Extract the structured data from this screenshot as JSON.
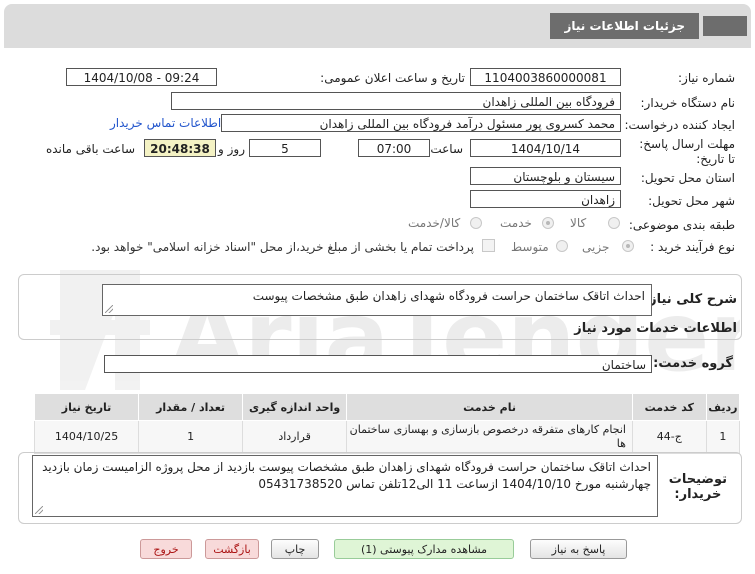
{
  "header": {
    "title": "جزئیات اطلاعات نیاز"
  },
  "watermark": {
    "text": "AriaTender.neT"
  },
  "form": {
    "need_number_label": "شماره نیاز:",
    "need_number": "1104003860000081",
    "announce_label": "تاریخ و ساعت اعلان عمومی:",
    "announce_value": "1404/10/08 - 09:24",
    "buyer_org_label": "نام دستگاه خریدار:",
    "buyer_org": "فرودگاه بین المللی زاهدان",
    "creator_label": "ایجاد کننده درخواست:",
    "creator": "محمد کسروی پور مسئول درآمد فرودگاه بین المللی زاهدان",
    "contact_link": "اطلاعات تماس خریدار",
    "deadline_label": "مهلت ارسال پاسخ: تا تاریخ:",
    "deadline_date": "1404/10/14",
    "time_label": "ساعت",
    "deadline_time": "07:00",
    "days_value": "5",
    "days_label": "روز و",
    "remaining_time": "20:48:38",
    "remaining_label": "ساعت باقی مانده",
    "province_label": "استان محل تحویل:",
    "province": "سیستان و بلوچستان",
    "city_label": "شهر محل تحویل:",
    "city": "زاهدان",
    "category_label": "طبقه بندی موضوعی:",
    "category_options": [
      "کالا",
      "خدمت",
      "کالا/خدمت"
    ],
    "process_label": "نوع فرآیند خرید :",
    "process_options": [
      "جزیی",
      "متوسط"
    ],
    "payment_note": "پرداخت تمام یا بخشی از مبلغ خرید،از محل \"اسناد خزانه اسلامی\" خواهد بود."
  },
  "summary": {
    "label": "شرح کلی نیاز:",
    "text": "احداث اتاقک ساختمان حراست فرودگاه شهدای زاهدان طبق مشخصات پیوست"
  },
  "services": {
    "heading": "اطلاعات خدمات مورد نیاز",
    "group_label": "گروه خدمت:",
    "group_value": "ساختمان",
    "columns": [
      "ردیف",
      "کد خدمت",
      "نام خدمت",
      "واحد اندازه گیری",
      "تعداد / مقدار",
      "تاریخ نیاز"
    ],
    "rows": [
      {
        "row": "1",
        "code": "ج-44",
        "name": "انجام کارهای متفرقه درخصوص بازسازی و بهسازی ساختمان ها",
        "unit": "قرارداد",
        "qty": "1",
        "date": "1404/10/25"
      }
    ]
  },
  "buyer_notes": {
    "label_line1": "توضیحات",
    "label_line2": "خریدار:",
    "line1": "احداث اتاقک ساختمان حراست فرودگاه شهدای زاهدان طبق مشخصات پیوست بازدید از محل پروژه الزامیست زمان بازدید",
    "line2": "چهارشنبه مورخ  1404/10/10 ازساعت 11 الی12تلفن تماس 05431738520"
  },
  "buttons": {
    "reply": "پاسخ به نیاز",
    "attachments": "مشاهده مدارک پیوستی (1)",
    "print": "چاپ",
    "back": "بازگشت",
    "exit": "خروج"
  }
}
